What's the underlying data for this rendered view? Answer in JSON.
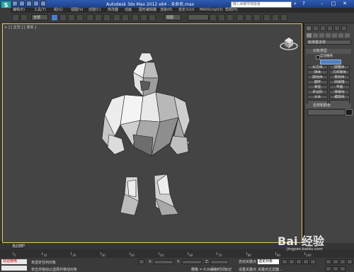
{
  "window": {
    "title": "Autodesk 3ds Max  2012 x64  -  未命名.max",
    "search_placeholder": "键入关键字或短语",
    "logo_text": "S"
  },
  "menu": [
    "编辑(E)",
    "工具(T)",
    "组(G)",
    "视图(V)",
    "创建(C)",
    "修改器",
    "动画",
    "图形编辑器",
    "渲染(R)",
    "自定义(U)",
    "MAXScript(X)",
    "帮助(H)"
  ],
  "toolbar": {
    "selection_filter": "全部",
    "view_dropdown": "视图",
    "named_selection": ""
  },
  "viewport": {
    "label": "+ ] [ 正交 ] [ 真实 ]",
    "border_color": "#e8c46b"
  },
  "command_panel": {
    "object_type_dropdown": "标准基本体",
    "rollout_object_type": "对象类型",
    "autogrid_label": "自动栅格",
    "buttons": [
      [
        "长方体",
        "圆锥体"
      ],
      [
        "球体",
        "几何球体"
      ],
      [
        "圆柱体",
        "管状体"
      ],
      [
        "圆环",
        "四棱锥"
      ],
      [
        "茶壶",
        "平面"
      ],
      [
        "多边形",
        "球棱柱"
      ],
      [
        "文本",
        "螺旋线"
      ],
      [
        "",
        ""
      ]
    ],
    "rollout_name_color": "名称和颜色"
  },
  "timeline": {
    "frame_label": "0 / 100",
    "ticks": [
      "0",
      "10",
      "20",
      "30",
      "40",
      "50",
      "60",
      "70",
      "80",
      "90",
      "100"
    ]
  },
  "status": {
    "maxscript_label": "欢迎使用",
    "line1": "未选定任何对象",
    "line2": "单击并拖动以选择并移动对象",
    "x_label": "X:",
    "y_label": "Y:",
    "z_label": "Z:",
    "grid_label": "栅格 = 0.0mm",
    "add_time_tag": "添加时间标记",
    "auto_key": "自动关键点",
    "set_key": "设置关键点",
    "selection_set": "选定对象",
    "key_filter": "关键点过滤器..."
  },
  "watermark": {
    "brand": "Bai 经验",
    "url": "jingyan.baidu.com"
  }
}
